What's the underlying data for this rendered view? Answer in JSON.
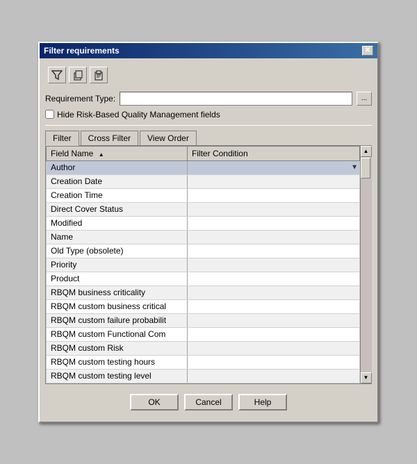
{
  "dialog": {
    "title": "Filter requirements",
    "close_label": "✕"
  },
  "toolbar": {
    "btn1_icon": "🔰",
    "btn2_icon": "📋",
    "btn3_icon": "📄"
  },
  "requirement_type": {
    "label": "Requirement Type:",
    "value": "",
    "placeholder": "",
    "browse_label": "..."
  },
  "hide_checkbox": {
    "label": "Hide Risk-Based Quality Management fields",
    "checked": false
  },
  "tabs": [
    {
      "id": "filter",
      "label": "Filter",
      "active": true
    },
    {
      "id": "cross-filter",
      "label": "Cross Filter",
      "active": false
    },
    {
      "id": "view-order",
      "label": "View Order",
      "active": false
    }
  ],
  "table": {
    "headers": [
      {
        "id": "field-name",
        "label": "Field Name",
        "sort": "▲"
      },
      {
        "id": "filter-condition",
        "label": "Filter Condition"
      }
    ],
    "rows": [
      {
        "field": "Author",
        "condition": "",
        "selected": true
      },
      {
        "field": "Creation Date",
        "condition": ""
      },
      {
        "field": "Creation Time",
        "condition": ""
      },
      {
        "field": "Direct Cover Status",
        "condition": ""
      },
      {
        "field": "Modified",
        "condition": ""
      },
      {
        "field": "Name",
        "condition": ""
      },
      {
        "field": "Old Type (obsolete)",
        "condition": ""
      },
      {
        "field": "Priority",
        "condition": ""
      },
      {
        "field": "Product",
        "condition": ""
      },
      {
        "field": "RBQM business criticality",
        "condition": ""
      },
      {
        "field": "RBQM custom business critical",
        "condition": ""
      },
      {
        "field": "RBQM custom failure probabilit",
        "condition": ""
      },
      {
        "field": "RBQM custom Functional Com",
        "condition": ""
      },
      {
        "field": "RBQM custom Risk",
        "condition": ""
      },
      {
        "field": "RBQM custom testing hours",
        "condition": ""
      },
      {
        "field": "RBQM custom testing level",
        "condition": ""
      }
    ]
  },
  "buttons": {
    "ok": "OK",
    "cancel": "Cancel",
    "help": "Help"
  }
}
